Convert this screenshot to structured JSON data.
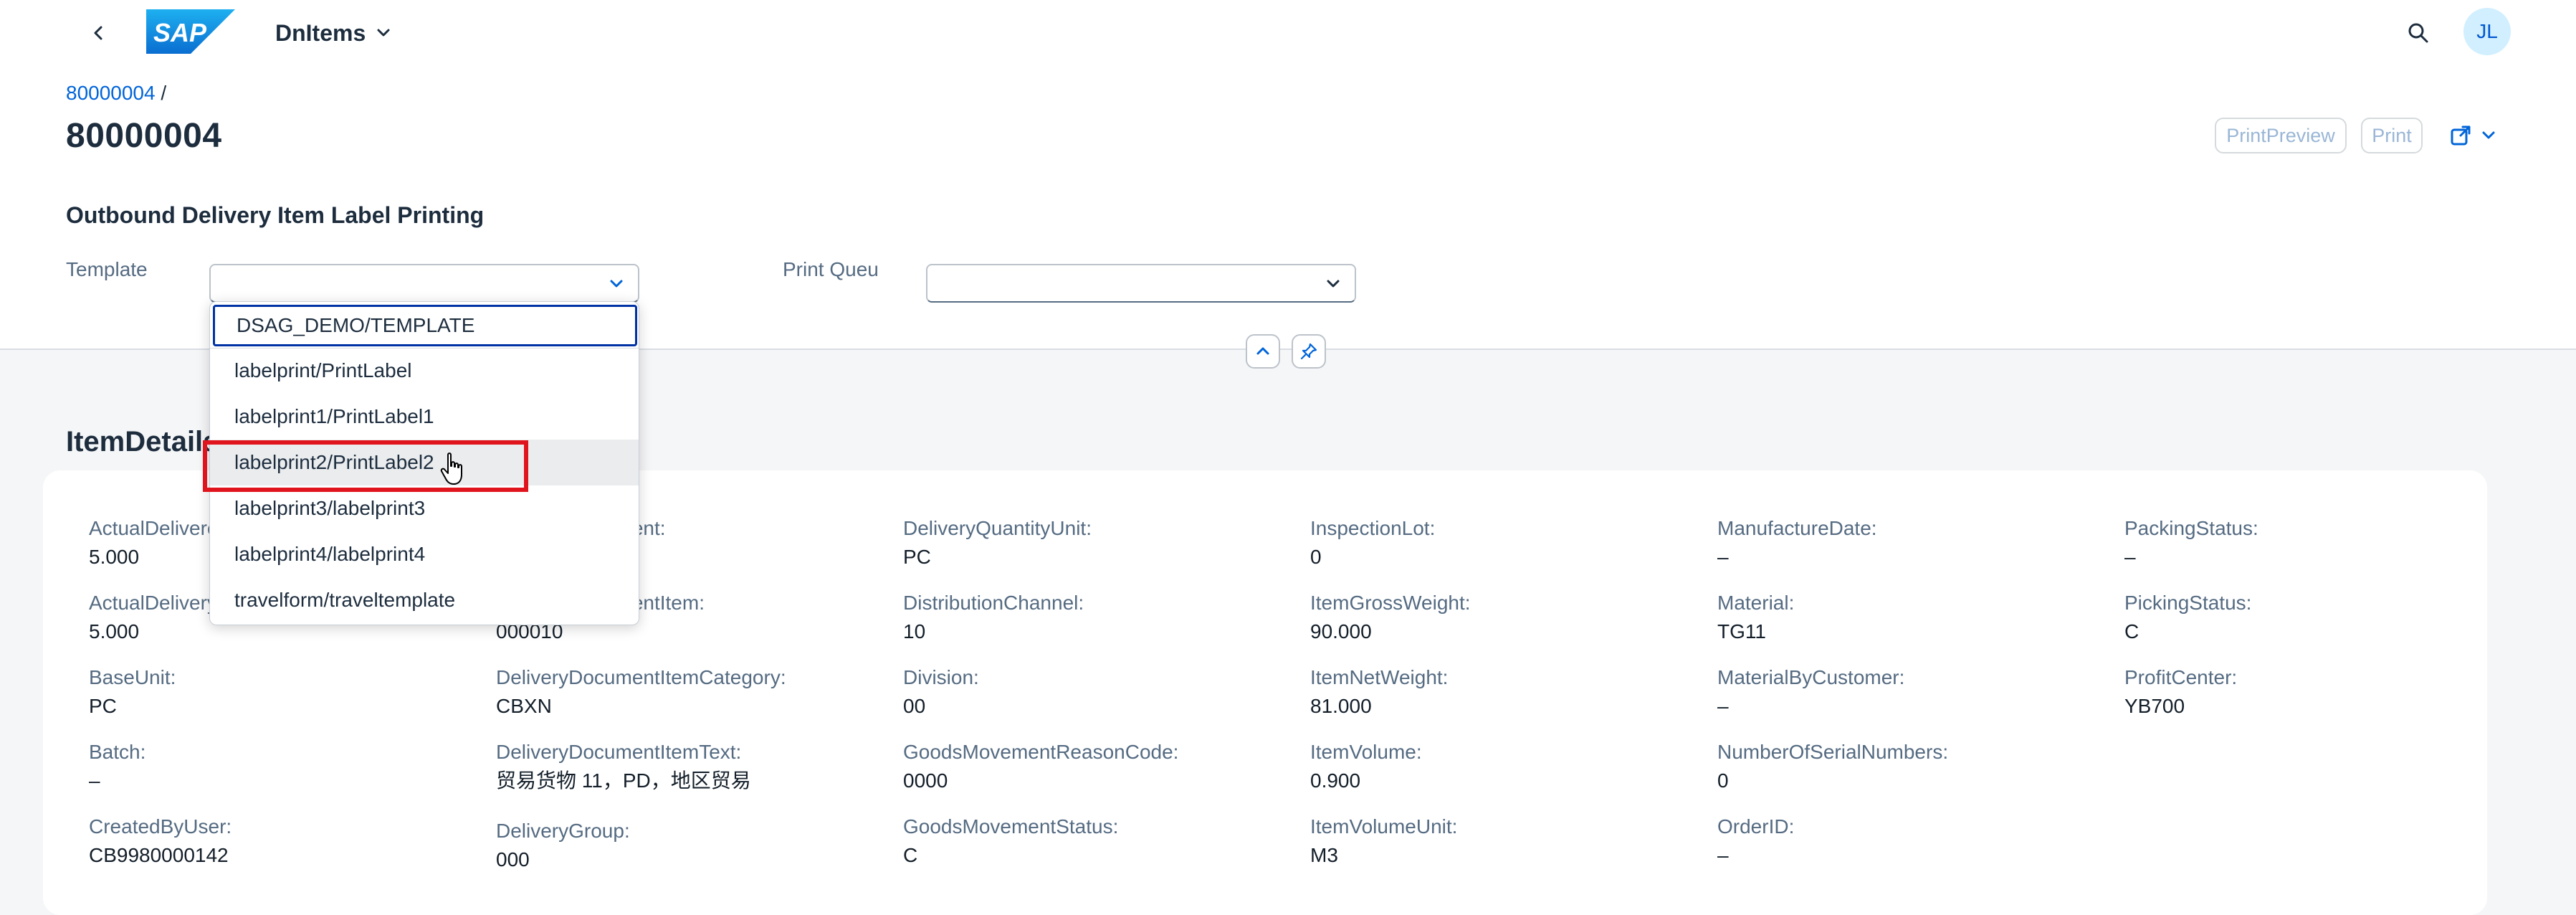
{
  "shell": {
    "app_title": "DnItems",
    "logo_text": "SAP",
    "avatar_initials": "JL",
    "brand_color": "#0a6ed1"
  },
  "header": {
    "breadcrumb_link": "80000004",
    "breadcrumb_sep": "/",
    "title": "80000004",
    "print_preview_label": "PrintPreview",
    "print_label": "Print"
  },
  "form": {
    "section_title": "Outbound Delivery Item Label Printing",
    "template_label": "Template",
    "template_value": "",
    "print_queue_label": "Print Queu",
    "print_queue_value": ""
  },
  "dropdown": {
    "options": [
      "DSAG_DEMO/TEMPLATE",
      "labelprint/PrintLabel",
      "labelprint1/PrintLabel1",
      "labelprint2/PrintLabel2",
      "labelprint3/labelprint3",
      "labelprint4/labelprint4",
      "travelform/traveltemplate"
    ],
    "focused_index": 0,
    "hovered_index": 3,
    "highlight_color": "#e0141c"
  },
  "items": {
    "title": "ItemDetails",
    "columns": [
      [
        {
          "k": "ActualDeliveredQuantityInBaseUnit:",
          "v": "5.000"
        },
        {
          "k": "ActualDeliveryQuantity:",
          "v": "5.000"
        },
        {
          "k": "BaseUnit:",
          "v": "PC"
        },
        {
          "k": "Batch:",
          "v": "–"
        },
        {
          "k": "CreatedByUser:",
          "v": "CB9980000142"
        }
      ],
      [
        {
          "k": "DeliveryDocument:",
          "v": ""
        },
        {
          "k": "DeliveryDocumentItem:",
          "v": "000010"
        },
        {
          "k": "DeliveryDocumentItemCategory:",
          "v": "CBXN"
        },
        {
          "k": "DeliveryDocumentItemText:",
          "v": "贸易货物 11，PD，地区贸易"
        },
        {
          "k": "DeliveryGroup:",
          "v": "000"
        }
      ],
      [
        {
          "k": "DeliveryQuantityUnit:",
          "v": "PC"
        },
        {
          "k": "DistributionChannel:",
          "v": "10"
        },
        {
          "k": "Division:",
          "v": "00"
        },
        {
          "k": "GoodsMovementReasonCode:",
          "v": "0000"
        },
        {
          "k": "GoodsMovementStatus:",
          "v": "C"
        }
      ],
      [
        {
          "k": "InspectionLot:",
          "v": "0"
        },
        {
          "k": "ItemGrossWeight:",
          "v": "90.000"
        },
        {
          "k": "ItemNetWeight:",
          "v": "81.000"
        },
        {
          "k": "ItemVolume:",
          "v": "0.900"
        },
        {
          "k": "ItemVolumeUnit:",
          "v": "M3"
        }
      ],
      [
        {
          "k": "ManufactureDate:",
          "v": "–"
        },
        {
          "k": "Material:",
          "v": "TG11"
        },
        {
          "k": "MaterialByCustomer:",
          "v": "–"
        },
        {
          "k": "NumberOfSerialNumbers:",
          "v": "0"
        },
        {
          "k": "OrderID:",
          "v": "–"
        }
      ],
      [
        {
          "k": "PackingStatus:",
          "v": "–"
        },
        {
          "k": "PickingStatus:",
          "v": "C"
        },
        {
          "k": "ProfitCenter:",
          "v": "YB700"
        }
      ]
    ]
  }
}
